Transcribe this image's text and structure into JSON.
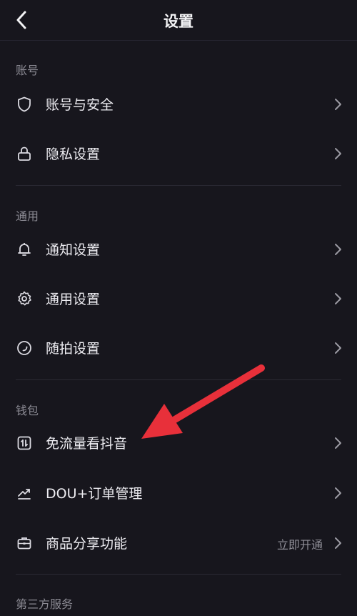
{
  "header": {
    "title": "设置"
  },
  "sections": {
    "account": {
      "label": "账号",
      "items": [
        {
          "label": "账号与安全",
          "icon": "shield-icon"
        },
        {
          "label": "隐私设置",
          "icon": "lock-icon"
        }
      ]
    },
    "general": {
      "label": "通用",
      "items": [
        {
          "label": "通知设置",
          "icon": "bell-icon"
        },
        {
          "label": "通用设置",
          "icon": "gear-icon"
        },
        {
          "label": "随拍设置",
          "icon": "circle-capture-icon"
        }
      ]
    },
    "wallet": {
      "label": "钱包",
      "items": [
        {
          "label": "免流量看抖音",
          "icon": "data-traffic-icon"
        },
        {
          "label": "DOU+订单管理",
          "icon": "trend-icon"
        },
        {
          "label": "商品分享功能",
          "icon": "briefcase-icon",
          "extra": "立即开通"
        }
      ]
    },
    "third_party": {
      "label": "第三方服务"
    }
  },
  "colors": {
    "background": "#17161d",
    "annotation_arrow": "#e8303a"
  }
}
